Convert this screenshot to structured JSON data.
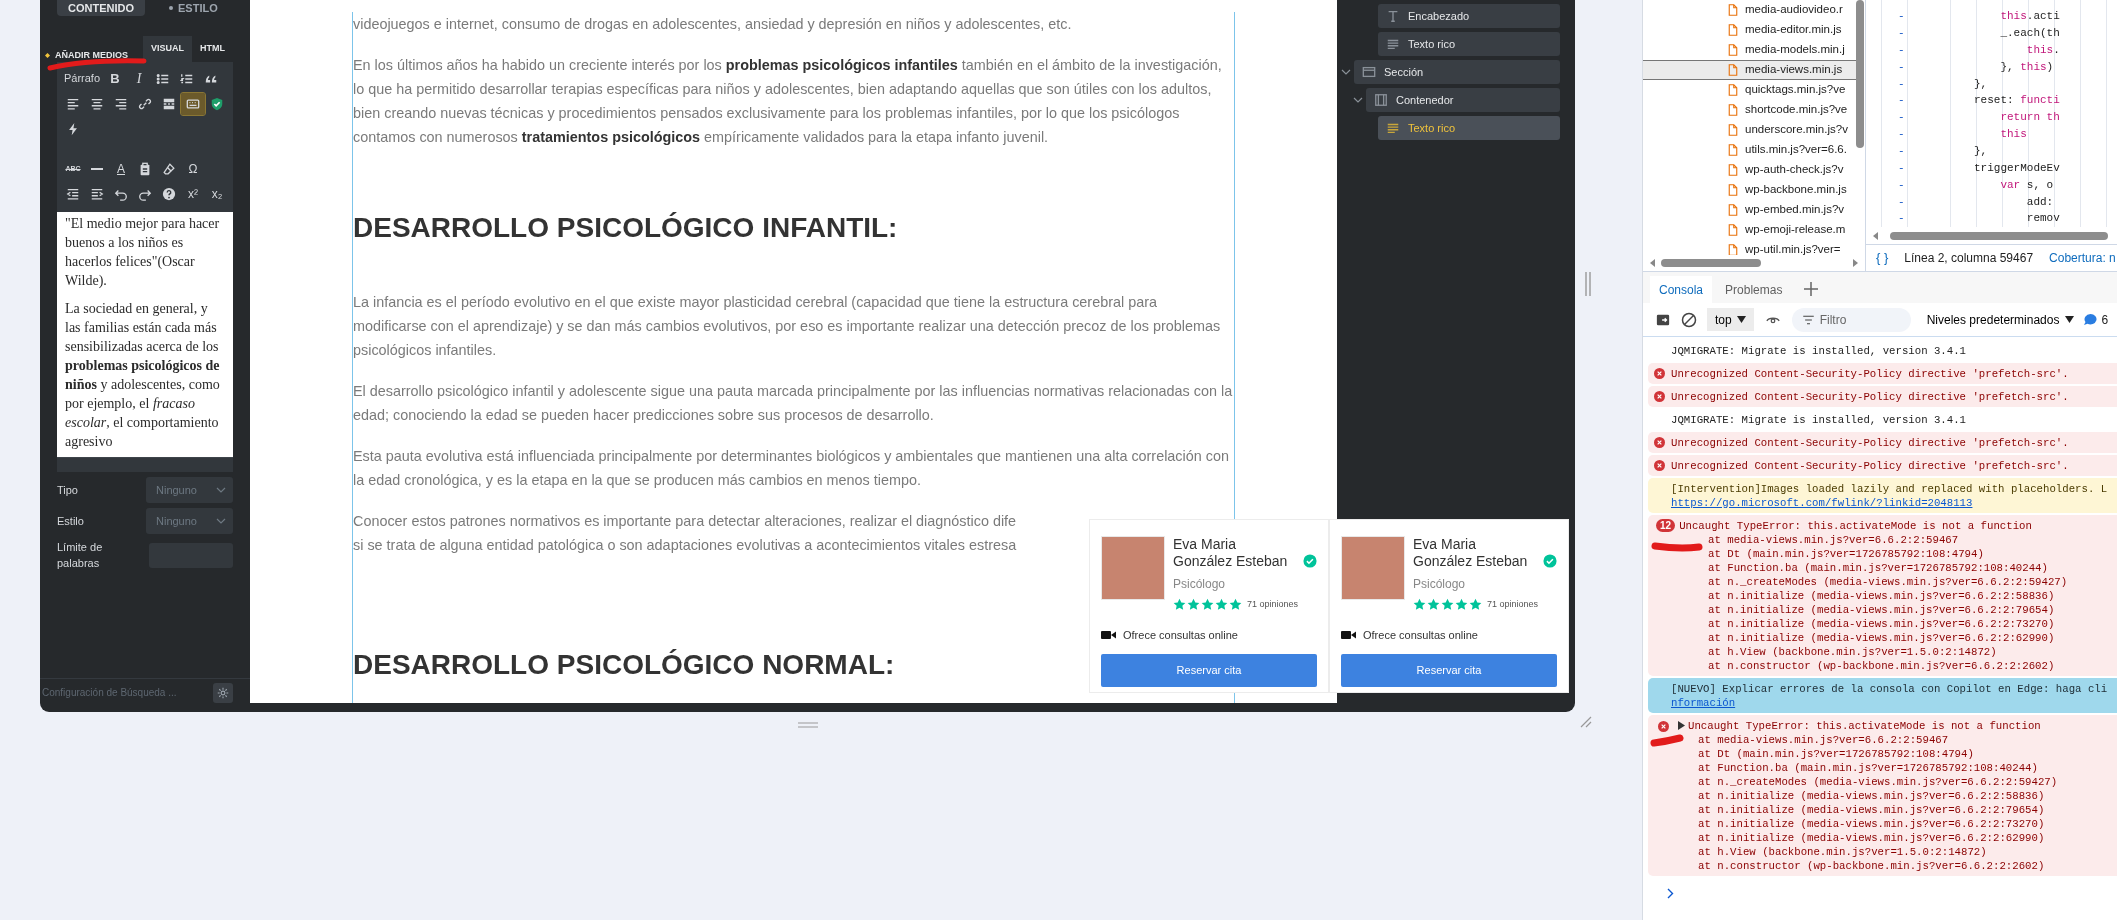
{
  "editor_panel": {
    "tabs": [
      {
        "label": "CONTENIDO",
        "selected": true
      },
      {
        "label": "ESTILO",
        "selected": false
      }
    ],
    "media_button": {
      "label": "AÑADIR MEDIOS"
    },
    "mode_tabs": [
      {
        "label": "VISUAL",
        "selected": true
      },
      {
        "label": "HTML",
        "selected": false
      }
    ],
    "toolbar": {
      "groups": [
        [
          [
            {
              "kind": "format",
              "text": "Párrafo",
              "active": false
            },
            {
              "kind": "bold",
              "text": "B",
              "active": false
            },
            {
              "kind": "italic",
              "text": "I",
              "active": false
            },
            {
              "kind": "bullets",
              "active": false
            },
            {
              "kind": "numbers",
              "active": false
            },
            {
              "kind": "quote",
              "active": false
            }
          ],
          [
            {
              "kind": "align-left",
              "active": false
            },
            {
              "kind": "align-center",
              "active": false
            },
            {
              "kind": "align-right",
              "active": false
            },
            {
              "kind": "link",
              "active": false
            },
            {
              "kind": "readmore",
              "active": false
            },
            {
              "kind": "toggle",
              "active": true
            },
            {
              "kind": "check",
              "active": false
            }
          ],
          [
            {
              "kind": "bolt",
              "active": false
            }
          ]
        ],
        [
          [
            {
              "kind": "strike",
              "text": "ABC",
              "active": false
            },
            {
              "kind": "hr",
              "active": false
            },
            {
              "kind": "color",
              "text": "A",
              "active": false
            },
            {
              "kind": "paste",
              "active": false
            },
            {
              "kind": "eraser",
              "active": false
            },
            {
              "kind": "symbol",
              "text": "Ω",
              "active": false
            }
          ],
          [
            {
              "kind": "outdent",
              "active": false
            },
            {
              "kind": "indent",
              "active": false
            },
            {
              "kind": "undo",
              "active": false
            },
            {
              "kind": "redo",
              "active": false
            },
            {
              "kind": "help",
              "active": false
            },
            {
              "kind": "superscript",
              "text": "x²",
              "active": false
            },
            {
              "kind": "subscript",
              "text": "x₂",
              "active": false
            }
          ]
        ]
      ]
    },
    "content": [
      "\"El medio mejor para hacer buenos a los niños es hacerlos felices\"(Oscar Wilde).",
      "La sociedad en general, y las familias están cada más sensibilizadas acerca de los **problemas psicológicos de niños** y adolescentes, como por ejemplo, el *fracaso escolar*, el comportamiento agresivo"
    ],
    "fields": [
      {
        "kind": "select",
        "label": "Tipo",
        "value": "Ninguno"
      },
      {
        "kind": "select",
        "label": "Estilo",
        "value": "Ninguno"
      },
      {
        "kind": "input",
        "label": "Límite de palabras"
      }
    ],
    "footer": {
      "label": "Configuración de Búsqueda ..."
    }
  },
  "page": {
    "blocks": [
      {
        "kind": "paragraph",
        "text": "videojuegos e internet, consumo de drogas en adolescentes, ansiedad y depresión en niños y adolescentes, etc."
      },
      {
        "kind": "paragraph",
        "text": "En los últimos años ha habido un creciente interés por los **problemas psicológicos infantiles** también en el ámbito de la investigación, lo que ha permitido desarrollar terapias específicas para niños y adolescentes, bien adaptando aquellas que son útiles con los adultos, bien creando nuevas técnicas y procedimientos pensados exclusivamente para los problemas infantiles, por lo que los psicólogos contamos con numerosos **tratamientos psicológicos** empíricamente validados para la etapa infanto juvenil."
      },
      {
        "kind": "heading",
        "text": "DESARROLLO PSICOLÓGICO INFANTIL:"
      },
      {
        "kind": "paragraph",
        "text": "La infancia es el período evolutivo en el que existe mayor plasticidad cerebral (capacidad que tiene la estructura cerebral para modificarse con el aprendizaje) y se dan más cambios evolutivos, por eso es importante realizar una detección precoz de los problemas psicológicos infantiles."
      },
      {
        "kind": "linked",
        "before": "El ",
        "link": "desarrollo psicológico infantil",
        "after": " y adolescente sigue una pauta marcada principalmente por las influencias normativas relacionadas con la edad; conociendo la edad se pueden hacer predicciones sobre sus procesos de desarrollo."
      },
      {
        "kind": "paragraph",
        "text": "Esta pauta evolutiva está influenciada principalmente por determinantes biológicos y ambientales que mantienen una alta correlación con la edad cronológica, y es la etapa en la que se producen más cambios en menos tiempo."
      },
      {
        "kind": "lines",
        "lines": [
          "Conocer estos patrones normativos es importante para detectar alteraciones, realizar el diagnóstico dife",
          "si se trata de alguna entidad patológica o son adaptaciones evolutivas a acontecimientos vitales estresa"
        ]
      },
      {
        "kind": "heading",
        "text": "DESARROLLO PSICOLÓGICO NORMAL:"
      }
    ]
  },
  "cards": [
    {
      "name": "Eva Maria González Esteban",
      "verified": true,
      "profession": "Psicólogo",
      "stars": 5,
      "reviews": "71 opiniones",
      "feature": "Ofrece consultas online",
      "button": "Reservar cita"
    },
    {
      "name": "Eva Maria González Esteban",
      "verified": true,
      "profession": "Psicólogo",
      "stars": 5,
      "reviews": "71 opiniones",
      "feature": "Ofrece consultas online",
      "button": "Reservar cita"
    }
  ],
  "navigator": {
    "items": [
      {
        "children": [
          {
            "children": [
              {
                "label": "Encabezado",
                "kind": "heading",
                "selected": false
              },
              {
                "label": "Texto rico",
                "kind": "text",
                "selected": false
              }
            ]
          }
        ]
      },
      {
        "label": "Sección",
        "kind": "section",
        "selected": false,
        "expanded": true,
        "children": [
          {
            "label": "Contenedor",
            "kind": "container",
            "selected": false,
            "expanded": true,
            "children": [
              {
                "label": "Texto rico",
                "kind": "text",
                "selected": true
              }
            ]
          }
        ]
      }
    ]
  },
  "devtools": {
    "files": [
      {
        "name": "media-audiovideo.r",
        "selected": false
      },
      {
        "name": "media-editor.min.js",
        "selected": false
      },
      {
        "name": "media-models.min.j",
        "selected": false
      },
      {
        "name": "media-views.min.js",
        "selected": true
      },
      {
        "name": "quicktags.min.js?ve",
        "selected": false
      },
      {
        "name": "shortcode.min.js?ve",
        "selected": false
      },
      {
        "name": "underscore.min.js?v",
        "selected": false
      },
      {
        "name": "utils.min.js?ver=6.6.",
        "selected": false
      },
      {
        "name": "wp-auth-check.js?v",
        "selected": false
      },
      {
        "name": "wp-backbone.min.js",
        "selected": false
      },
      {
        "name": "wp-embed.min.js?v",
        "selected": false
      },
      {
        "name": "wp-emoji-release.m",
        "selected": false
      },
      {
        "name": "wp-util.min.js?ver=",
        "selected": false
      }
    ],
    "code_lines": [
      {
        "children": [
          {
            "marker": "-",
            "tokens": [
              {
                "kind": "keyword",
                "text": "this"
              },
              {
                "kind": "plain",
                "text": ".acti"
              }
            ]
          },
          {
            "marker": "-",
            "tokens": [
              {
                "kind": "plain",
                "text": "_.each(th"
              }
            ],
            "children": [
              {
                "marker": "-",
                "tokens": [
                  {
                    "kind": "keyword",
                    "text": "this"
                  },
                  {
                    "kind": "plain",
                    "text": "."
                  }
                ]
              }
            ]
          },
          {
            "marker": "-",
            "tokens": [
              {
                "kind": "plain",
                "text": "},"
              },
              {
                "kind": "keyword",
                "text": " this"
              },
              {
                "kind": "plain",
                "text": ")"
              }
            ]
          }
        ]
      },
      {
        "marker": "-",
        "tokens": [
          {
            "kind": "plain",
            "text": "},"
          }
        ]
      },
      {
        "marker": "-",
        "tokens": [
          {
            "kind": "plain",
            "text": "reset:"
          },
          {
            "kind": "keyword",
            "text": " functi"
          }
        ],
        "children": [
          {
            "marker": "-",
            "tokens": [
              {
                "kind": "keyword",
                "text": "return th"
              }
            ]
          },
          {
            "marker": "-",
            "tokens": [
              {
                "kind": "keyword",
                "text": "this"
              }
            ]
          }
        ]
      },
      {
        "marker": "-",
        "tokens": [
          {
            "kind": "plain",
            "text": "},"
          }
        ]
      },
      {
        "marker": "-",
        "tokens": [
          {
            "kind": "plain",
            "text": "triggerModeEv"
          }
        ],
        "children": [
          {
            "marker": "-",
            "tokens": [
              {
                "kind": "keyword",
                "text": "var"
              },
              {
                "kind": "plain",
                "text": " s, o"
              }
            ],
            "children": [
              {
                "marker": "-",
                "tokens": [
                  {
                    "kind": "plain",
                    "text": "add:"
                  }
                ]
              },
              {
                "marker": "-",
                "tokens": [
                  {
                    "kind": "plain",
                    "text": "remov"
                  }
                ]
              }
            ]
          }
        ]
      }
    ],
    "pretty_print": "{ }",
    "position": "Línea 2, columna 59467",
    "coverage": "Cobertura: n",
    "tabs": [
      {
        "label": "Consola",
        "selected": true
      },
      {
        "label": "Problemas",
        "selected": false
      }
    ],
    "context": "top",
    "filter_placeholder": "Filtro",
    "levels": "Niveles predeterminados",
    "badge": "6",
    "messages": [
      {
        "kind": "log",
        "text": "JQMIGRATE: Migrate is installed, version 3.4.1"
      },
      {
        "kind": "error",
        "text": "Unrecognized Content-Security-Policy directive 'prefetch-src'."
      },
      {
        "kind": "error",
        "text": "Unrecognized Content-Security-Policy directive 'prefetch-src'."
      },
      {
        "kind": "log",
        "text": "JQMIGRATE: Migrate is installed, version 3.4.1"
      },
      {
        "kind": "error",
        "text": "Unrecognized Content-Security-Policy directive 'prefetch-src'."
      },
      {
        "kind": "error",
        "text": "Unrecognized Content-Security-Policy directive 'prefetch-src'."
      },
      {
        "kind": "warning",
        "text": "[Intervention]Images loaded lazily and replaced with placeholders. L",
        "link": "https://go.microsoft.com/fwlink/?linkid=2048113"
      },
      {
        "kind": "error",
        "count": "12",
        "collapsible": false,
        "text": "Uncaught TypeError: this.activateMode is not a function",
        "stack": [
          {
            "call": "at ",
            "link": "media-views.min.js?ver=6.6.2:2:59467"
          },
          {
            "call": "at Dt (",
            "link": "main.min.js?ver=1726785792:108:4794",
            "close": ")"
          },
          {
            "call": "at Function.ba (",
            "link": "main.min.js?ver=1726785792:108:40244",
            "close": ")"
          },
          {
            "call": "at n._createModes (",
            "link": "media-views.min.js?ver=6.6.2:2:59427",
            "close": ")"
          },
          {
            "call": "at n.initialize (",
            "link": "media-views.min.js?ver=6.6.2:2:58836",
            "close": ")"
          },
          {
            "call": "at n.initialize (",
            "link": "media-views.min.js?ver=6.6.2:2:79654",
            "close": ")"
          },
          {
            "call": "at n.initialize (",
            "link": "media-views.min.js?ver=6.6.2:2:73270",
            "close": ")"
          },
          {
            "call": "at n.initialize (",
            "link": "media-views.min.js?ver=6.6.2:2:62990",
            "close": ")"
          },
          {
            "call": "at h.View (",
            "link": "backbone.min.js?ver=1.5.0:2:14872",
            "close": ")"
          },
          {
            "call": "at n.constructor (",
            "link": "wp-backbone.min.js?ver=6.6.2:2:2602",
            "close": ")"
          }
        ]
      },
      {
        "kind": "info",
        "text": "[NUEVO] Explicar errores de la consola con Copilot en Edge: haga cli",
        "link": "nformación"
      },
      {
        "kind": "error",
        "collapsible": true,
        "text": "Uncaught TypeError: this.activateMode is not a function",
        "stack": [
          {
            "call": "at ",
            "link": "media-views.min.js?ver=6.6.2:2:59467"
          },
          {
            "call": "at Dt (",
            "link": "main.min.js?ver=1726785792:108:4794",
            "close": ")"
          },
          {
            "call": "at Function.ba (",
            "link": "main.min.js?ver=1726785792:108:40244",
            "close": ")"
          },
          {
            "call": "at n._createModes (",
            "link": "media-views.min.js?ver=6.6.2:2:59427",
            "close": ")"
          },
          {
            "call": "at n.initialize (",
            "link": "media-views.min.js?ver=6.6.2:2:58836",
            "close": ")"
          },
          {
            "call": "at n.initialize (",
            "link": "media-views.min.js?ver=6.6.2:2:79654",
            "close": ")"
          },
          {
            "call": "at n.initialize (",
            "link": "media-views.min.js?ver=6.6.2:2:73270",
            "close": ")"
          },
          {
            "call": "at n.initialize (",
            "link": "media-views.min.js?ver=6.6.2:2:62990",
            "close": ")"
          },
          {
            "call": "at h.View (",
            "link": "backbone.min.js?ver=1.5.0:2:14872",
            "close": ")"
          },
          {
            "call": "at n.constructor (",
            "link": "wp-backbone.min.js?ver=6.6.2:2:2602",
            "close": ")"
          }
        ]
      }
    ]
  }
}
